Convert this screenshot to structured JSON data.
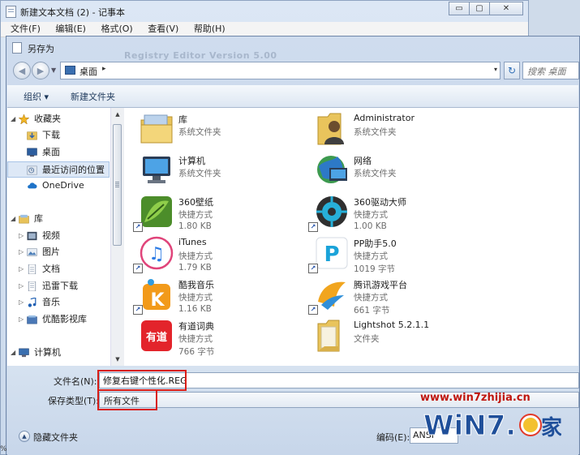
{
  "notepad": {
    "title": "新建文本文档 (2) - 记事本",
    "menu": [
      "文件(F)",
      "编辑(E)",
      "格式(O)",
      "查看(V)",
      "帮助(H)"
    ],
    "caption": {
      "minimize": "▭",
      "maximize": "▢",
      "close": "✕"
    }
  },
  "dialog": {
    "title": "另存为",
    "watermark": "Registry Editor Version 5.00",
    "address": {
      "location": "桌面",
      "separator": "▸",
      "dropdown": "▾"
    },
    "refresh_glyph": "↻",
    "search": {
      "placeholder": "搜索 桌面"
    },
    "toolbar": {
      "organize": "组织 ▾",
      "new_folder": "新建文件夹"
    },
    "nav": {
      "favorites": "收藏夹",
      "downloads": "下载",
      "desktop": "桌面",
      "recent": "最近访问的位置",
      "onedrive": "OneDrive",
      "libraries": "库",
      "videos": "视频",
      "pictures": "图片",
      "documents": "文档",
      "thunder": "迅雷下载",
      "music": "音乐",
      "youku": "优酷影视库",
      "computer": "计算机"
    },
    "files": [
      {
        "name": "库",
        "type": "系统文件夹",
        "size": ""
      },
      {
        "name": "Administrator",
        "type": "系统文件夹",
        "size": ""
      },
      {
        "name": "计算机",
        "type": "系统文件夹",
        "size": ""
      },
      {
        "name": "网络",
        "type": "系统文件夹",
        "size": ""
      },
      {
        "name": "360壁纸",
        "type": "快捷方式",
        "size": "1.80 KB"
      },
      {
        "name": "360驱动大师",
        "type": "快捷方式",
        "size": "1.00 KB"
      },
      {
        "name": "iTunes",
        "type": "快捷方式",
        "size": "1.79 KB"
      },
      {
        "name": "PP助手5.0",
        "type": "快捷方式",
        "size": "1019 字节"
      },
      {
        "name": "酷我音乐",
        "type": "快捷方式",
        "size": "1.16 KB"
      },
      {
        "name": "腾讯游戏平台",
        "type": "快捷方式",
        "size": "661 字节"
      },
      {
        "name": "有道词典",
        "type": "快捷方式",
        "size": "766 字节"
      },
      {
        "name": "Lightshot 5.2.1.1",
        "type": "文件夹",
        "size": ""
      }
    ],
    "icon_text": {
      "itunes": "♫",
      "pp": "P",
      "kuwo": "K",
      "youdao": "有道"
    },
    "form": {
      "filename_label": "文件名(N):",
      "filename_value": "修复右键个性化.REG",
      "filetype_label": "保存类型(T):",
      "filetype_value": "所有文件",
      "hide_folders": "隐藏文件夹",
      "encoding_label": "编码(E):",
      "encoding_value": "ANSI"
    }
  },
  "site": {
    "url": "www.win7zhijia.cn",
    "logo_text": "WiN7.",
    "logo_suffix": "家"
  },
  "stray_char": "%",
  "colors": {
    "highlight_red": "#d91e18",
    "link_blue": "#1e395b",
    "title_bg": "#cfdcee"
  }
}
